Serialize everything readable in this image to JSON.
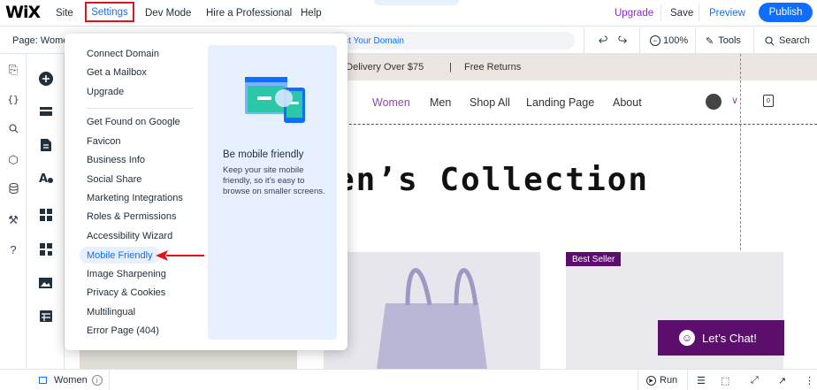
{
  "topbar": {
    "logo": "WiX",
    "site": "Site",
    "settings": "Settings",
    "dev_mode": "Dev Mode",
    "hire": "Hire a Professional",
    "help": "Help",
    "upgrade": "Upgrade",
    "save": "Save",
    "preview": "Preview",
    "publish": "Publish"
  },
  "subbar": {
    "page_label": "Page: Wome",
    "url_text": "nect Your Domain",
    "zoom": "100%",
    "tools": "Tools",
    "search": "Search"
  },
  "dropdown": {
    "items_group1": [
      "Connect Domain",
      "Get a Mailbox",
      "Upgrade"
    ],
    "items_group2": [
      "Get Found on Google",
      "Favicon",
      "Business Info",
      "Social Share",
      "Marketing Integrations",
      "Roles & Permissions",
      "Accessibility Wizard",
      "Mobile Friendly",
      "Image Sharpening",
      "Privacy & Cookies",
      "Multilingual",
      "Error Page (404)"
    ],
    "panel_title": "Be mobile friendly",
    "panel_desc": "Keep your site mobile friendly, so it's easy to browse on smaller screens."
  },
  "canvas": {
    "promo_text": "e Delivery Over $75",
    "promo_sep": "|",
    "promo_returns": "Free Returns",
    "nav": [
      "e",
      "Women",
      "Men",
      "Shop All",
      "Landing Page",
      "About"
    ],
    "cart_count": "0",
    "hero": "en’s Collection",
    "badge": "Best Seller",
    "chat": "Let’s Chat!"
  },
  "bottombar": {
    "page": "Women",
    "run": "Run"
  },
  "colors": {
    "accent": "#116dff",
    "highlight_red": "#e0131b",
    "brand_purple": "#5b0e6b"
  }
}
